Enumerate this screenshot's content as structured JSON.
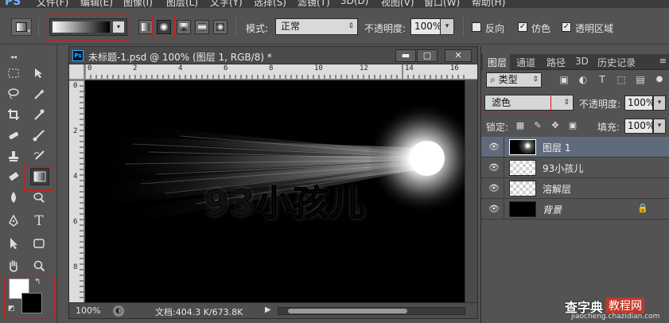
{
  "menubar": {
    "logo": "PS",
    "items": [
      "文件(F)",
      "编辑(E)",
      "图像(I)",
      "图层(L)",
      "文字(Y)",
      "选择(S)",
      "滤镜(T)",
      "3D(D)",
      "视图(V)",
      "窗口(W)",
      "帮助(H)"
    ]
  },
  "options": {
    "mode_label": "模式:",
    "mode_value": "正常",
    "opacity_label": "不透明度:",
    "opacity_value": "100%",
    "reverse_label": "反向",
    "dither_label": "仿色",
    "transparency_label": "透明区域",
    "reverse_checked": false,
    "dither_checked": true,
    "transparency_checked": true
  },
  "document": {
    "title": "未标题-1.psd @ 100% (图层 1, RGB/8) *",
    "canvas_text": "93小孩儿",
    "ruler_h": [
      "0",
      "2",
      "4",
      "6",
      "8",
      "10",
      "12",
      "14",
      "16"
    ],
    "ruler_v": [
      "0",
      "2",
      "4",
      "6",
      "8"
    ],
    "status": {
      "zoom": "100%",
      "doc_info": "文档:404.3 K/673.8K"
    }
  },
  "layers_panel": {
    "tabs": [
      "图层",
      "通道",
      "路径",
      "3D",
      "历史记录"
    ],
    "filter_label": "类型",
    "blend_mode": "滤色",
    "opacity_label": "不透明度:",
    "opacity_value": "100%",
    "lock_label": "锁定:",
    "fill_label": "填充:",
    "fill_value": "100%",
    "layers": [
      {
        "name": "图层 1",
        "selected": true
      },
      {
        "name": "93小孩儿",
        "selected": false
      },
      {
        "name": "溶解层",
        "selected": false
      },
      {
        "name": "背景",
        "selected": false
      }
    ]
  },
  "watermark": {
    "brand": "查字典",
    "tag": "教程网",
    "url": "jiaocheng.chazidian.com"
  },
  "colors": {
    "highlight_red": "#d21b1b",
    "foreground": "#ffffff",
    "background": "#000000",
    "selected_layer": "#5f6b7a"
  }
}
